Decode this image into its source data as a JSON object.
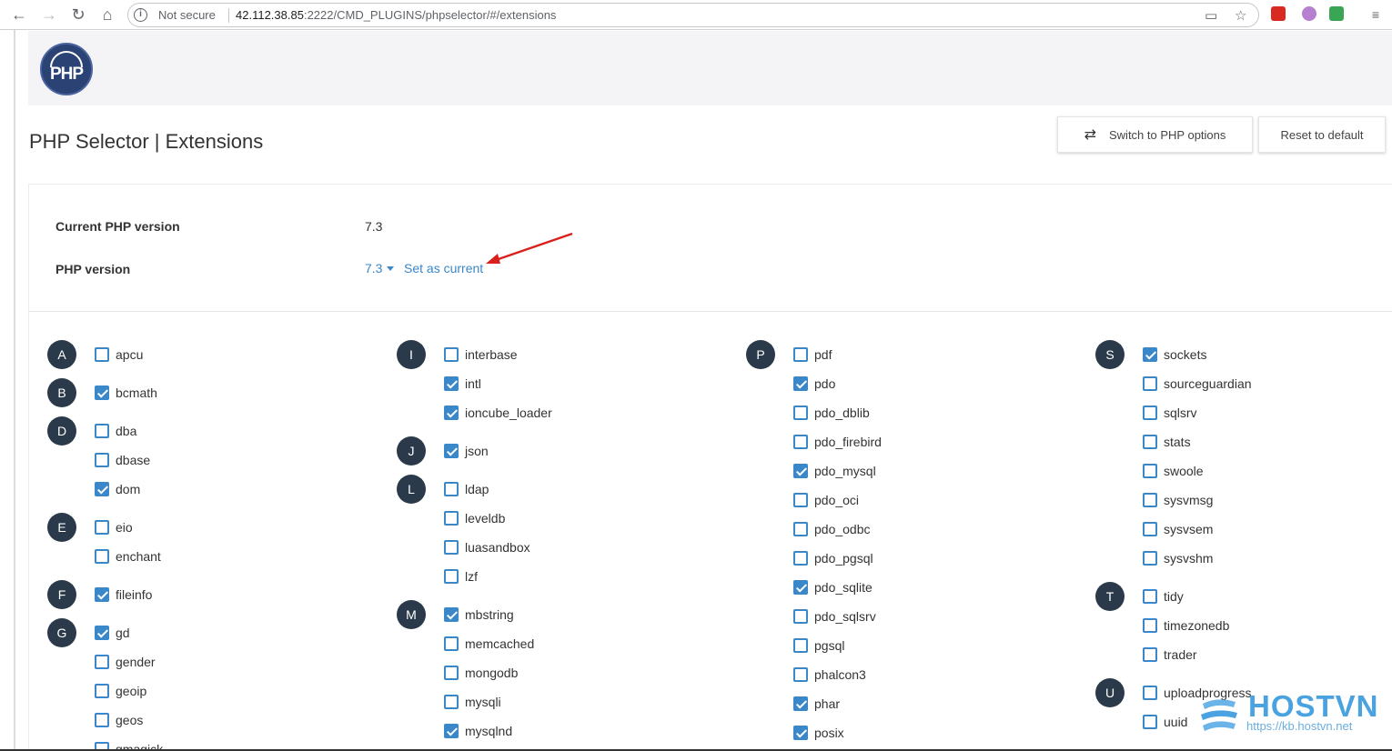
{
  "browser": {
    "security_label": "Not secure",
    "url_host": "42.112.38.85",
    "url_path": ":2222/CMD_PLUGINS/phpselector/#/extensions"
  },
  "header": {
    "logo_text": "PHP",
    "title": "PHP Selector | Extensions",
    "switch_button": "Switch to PHP options",
    "reset_button": "Reset to default"
  },
  "version": {
    "current_label": "Current PHP version",
    "current_value": "7.3",
    "php_version_label": "PHP version",
    "selected": "7.3",
    "set_current": "Set as current"
  },
  "extension_groups": [
    {
      "letter": "A",
      "items": [
        {
          "name": "apcu",
          "checked": false
        }
      ]
    },
    {
      "letter": "B",
      "items": [
        {
          "name": "bcmath",
          "checked": true
        }
      ]
    },
    {
      "letter": "D",
      "items": [
        {
          "name": "dba",
          "checked": false
        },
        {
          "name": "dbase",
          "checked": false
        },
        {
          "name": "dom",
          "checked": true
        }
      ]
    },
    {
      "letter": "E",
      "items": [
        {
          "name": "eio",
          "checked": false
        },
        {
          "name": "enchant",
          "checked": false
        }
      ]
    },
    {
      "letter": "F",
      "items": [
        {
          "name": "fileinfo",
          "checked": true
        }
      ]
    },
    {
      "letter": "G",
      "items": [
        {
          "name": "gd",
          "checked": true
        },
        {
          "name": "gender",
          "checked": false
        },
        {
          "name": "geoip",
          "checked": false
        },
        {
          "name": "geos",
          "checked": false
        },
        {
          "name": "gmagick",
          "checked": false
        }
      ]
    },
    {
      "letter": "I",
      "items": [
        {
          "name": "interbase",
          "checked": false
        },
        {
          "name": "intl",
          "checked": true
        },
        {
          "name": "ioncube_loader",
          "checked": true
        }
      ]
    },
    {
      "letter": "J",
      "items": [
        {
          "name": "json",
          "checked": true
        }
      ]
    },
    {
      "letter": "L",
      "items": [
        {
          "name": "ldap",
          "checked": false
        },
        {
          "name": "leveldb",
          "checked": false
        },
        {
          "name": "luasandbox",
          "checked": false
        },
        {
          "name": "lzf",
          "checked": false
        }
      ]
    },
    {
      "letter": "M",
      "items": [
        {
          "name": "mbstring",
          "checked": true
        },
        {
          "name": "memcached",
          "checked": false
        },
        {
          "name": "mongodb",
          "checked": false
        },
        {
          "name": "mysqli",
          "checked": false
        },
        {
          "name": "mysqlnd",
          "checked": true
        }
      ]
    },
    {
      "letter": "P",
      "items": [
        {
          "name": "pdf",
          "checked": false
        },
        {
          "name": "pdo",
          "checked": true
        },
        {
          "name": "pdo_dblib",
          "checked": false
        },
        {
          "name": "pdo_firebird",
          "checked": false
        },
        {
          "name": "pdo_mysql",
          "checked": true
        },
        {
          "name": "pdo_oci",
          "checked": false
        },
        {
          "name": "pdo_odbc",
          "checked": false
        },
        {
          "name": "pdo_pgsql",
          "checked": false
        },
        {
          "name": "pdo_sqlite",
          "checked": true
        },
        {
          "name": "pdo_sqlsrv",
          "checked": false
        },
        {
          "name": "pgsql",
          "checked": false
        },
        {
          "name": "phalcon3",
          "checked": false
        },
        {
          "name": "phar",
          "checked": true
        },
        {
          "name": "posix",
          "checked": true
        }
      ]
    },
    {
      "letter": "S",
      "items": [
        {
          "name": "sockets",
          "checked": true
        },
        {
          "name": "sourceguardian",
          "checked": false
        },
        {
          "name": "sqlsrv",
          "checked": false
        },
        {
          "name": "stats",
          "checked": false
        },
        {
          "name": "swoole",
          "checked": false
        },
        {
          "name": "sysvmsg",
          "checked": false
        },
        {
          "name": "sysvsem",
          "checked": false
        },
        {
          "name": "sysvshm",
          "checked": false
        }
      ]
    },
    {
      "letter": "T",
      "items": [
        {
          "name": "tidy",
          "checked": false
        },
        {
          "name": "timezonedb",
          "checked": false
        },
        {
          "name": "trader",
          "checked": false
        }
      ]
    },
    {
      "letter": "U",
      "items": [
        {
          "name": "uploadprogress",
          "checked": false
        },
        {
          "name": "uuid",
          "checked": false
        }
      ]
    }
  ],
  "watermark": {
    "brand": "HOSTVN",
    "url": "https://kb.hostvn.net"
  },
  "colors": {
    "accent": "#3a87c9",
    "letter_badge": "#2b3a4a",
    "php_logo": "#2b4275"
  }
}
